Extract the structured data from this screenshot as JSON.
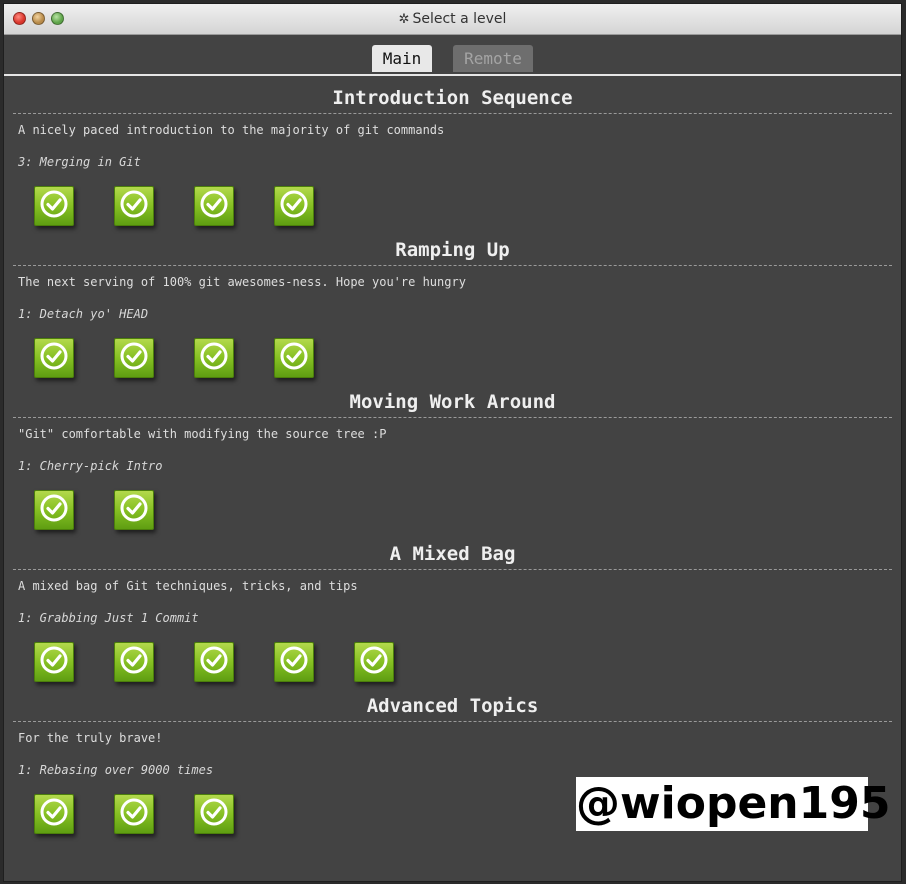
{
  "window": {
    "title": "Select a level",
    "title_icon": "gear-icon"
  },
  "tabs": [
    {
      "label": "Main",
      "active": true
    },
    {
      "label": "Remote",
      "active": false
    }
  ],
  "sequences": [
    {
      "title": "Introduction Sequence",
      "description": "A nicely paced introduction to the majority of git commands",
      "current_level": "3: Merging in Git",
      "levels_completed": [
        true,
        true,
        true,
        true
      ]
    },
    {
      "title": "Ramping Up",
      "description": "The next serving of 100% git awesomes-ness. Hope you're hungry",
      "current_level": "1: Detach yo' HEAD",
      "levels_completed": [
        true,
        true,
        true,
        true
      ]
    },
    {
      "title": "Moving Work Around",
      "description": "\"Git\" comfortable with modifying the source tree :P",
      "current_level": "1: Cherry-pick Intro",
      "levels_completed": [
        true,
        true
      ]
    },
    {
      "title": "A Mixed Bag",
      "description": "A mixed bag of Git techniques, tricks, and tips",
      "current_level": "1: Grabbing Just 1 Commit",
      "levels_completed": [
        true,
        true,
        true,
        true,
        true
      ]
    },
    {
      "title": "Advanced Topics",
      "description": "For the truly brave!",
      "current_level": "1: Rebasing over 9000 times",
      "levels_completed": [
        true,
        true,
        true
      ]
    }
  ],
  "watermark": "@wiopen195",
  "colors": {
    "level_complete": "#86c023",
    "panel_bg": "#434343"
  }
}
